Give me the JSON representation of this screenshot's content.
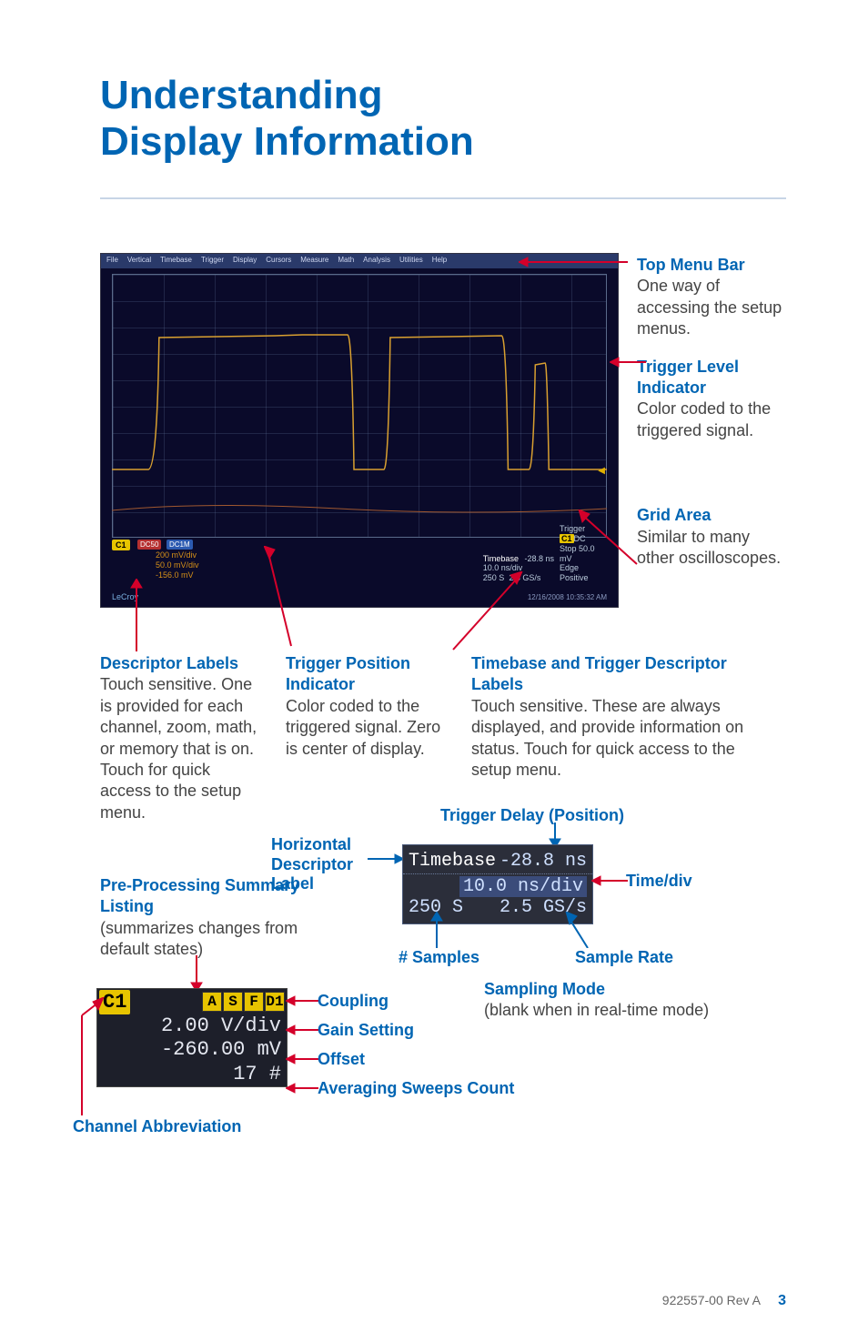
{
  "title_line1": "Understanding",
  "title_line2": "Display Information",
  "screenshot": {
    "menu": [
      "File",
      "Vertical",
      "Timebase",
      "Trigger",
      "Display",
      "Cursors",
      "Measure",
      "Math",
      "Analysis",
      "Utilities",
      "Help"
    ],
    "descriptor": {
      "channel": "C1",
      "badge1": "DC50",
      "badge2": "DC1M",
      "line1": "200 mV/div",
      "line2": "50.0 mV/div",
      "line3": "-156.0 mV"
    },
    "timebase": {
      "label": "Timebase",
      "delay": "-28.8 ns",
      "tdiv": "10.0 ns/div",
      "samples": "250 S",
      "rate": "2.5 GS/s"
    },
    "trigger": {
      "label": "Trigger",
      "ch": "C1",
      "mode": "DC",
      "stop": "Stop",
      "lvl": "50.0 mV",
      "edge": "Edge",
      "slope": "Positive"
    },
    "timestamp": "12/16/2008 10:35:32 AM",
    "brand": "LeCroy"
  },
  "right": {
    "top_menu": {
      "head": "Top Menu Bar",
      "body": "One way of accessing the setup menus."
    },
    "trigger_lvl": {
      "head": "Trigger Level Indicator",
      "body": "Color coded to the triggered signal."
    },
    "grid_area": {
      "head": "Grid Area",
      "body": "Similar to many other oscilloscopes."
    }
  },
  "below": {
    "desc_labels": {
      "head": "Descriptor Labels",
      "body": "Touch sensitive. One is provided for each channel, zoom, math, or memory that is on. Touch for quick access to the setup menu."
    },
    "trig_pos": {
      "head": "Trigger Position Indicator",
      "body": "Color coded to the triggered signal. Zero is center of display."
    },
    "tb_trig": {
      "head": "Timebase and Trigger Descriptor Labels",
      "body": "Touch sensitive. These are always displayed, and provide information on status. Touch for quick access to the setup menu."
    }
  },
  "trigdelay_label": "Trigger Delay (Position)",
  "hdesc_label": "Horizontal Descriptor Label",
  "preproc": {
    "head": "Pre-Processing Summary Listing",
    "body": "(summarizes changes from default states)"
  },
  "tb_chip": {
    "label": "Timebase",
    "delay": "-28.8 ns",
    "tdiv": "10.0 ns/div",
    "samples": "250 S",
    "rate": "2.5 GS/s"
  },
  "timediv_label": "Time/div",
  "samples_label": "# Samples",
  "sample_rate_label": "Sample Rate",
  "sampling_mode": {
    "head": "Sampling Mode",
    "body": "(blank when in real-time mode)"
  },
  "ch_chip": {
    "ch": "C1",
    "flags": [
      "A",
      "S",
      "F",
      "D1"
    ],
    "vdiv": "2.00 V/div",
    "offset": "-260.00 mV",
    "avg": "17 #"
  },
  "ch_anno": {
    "coupling": "Coupling",
    "gain": "Gain Setting",
    "offset": "Offset",
    "avg": "Averaging Sweeps Count"
  },
  "chan_abbr": "Channel Abbreviation",
  "footer": {
    "doc": "922557-00 Rev A",
    "page": "3"
  }
}
